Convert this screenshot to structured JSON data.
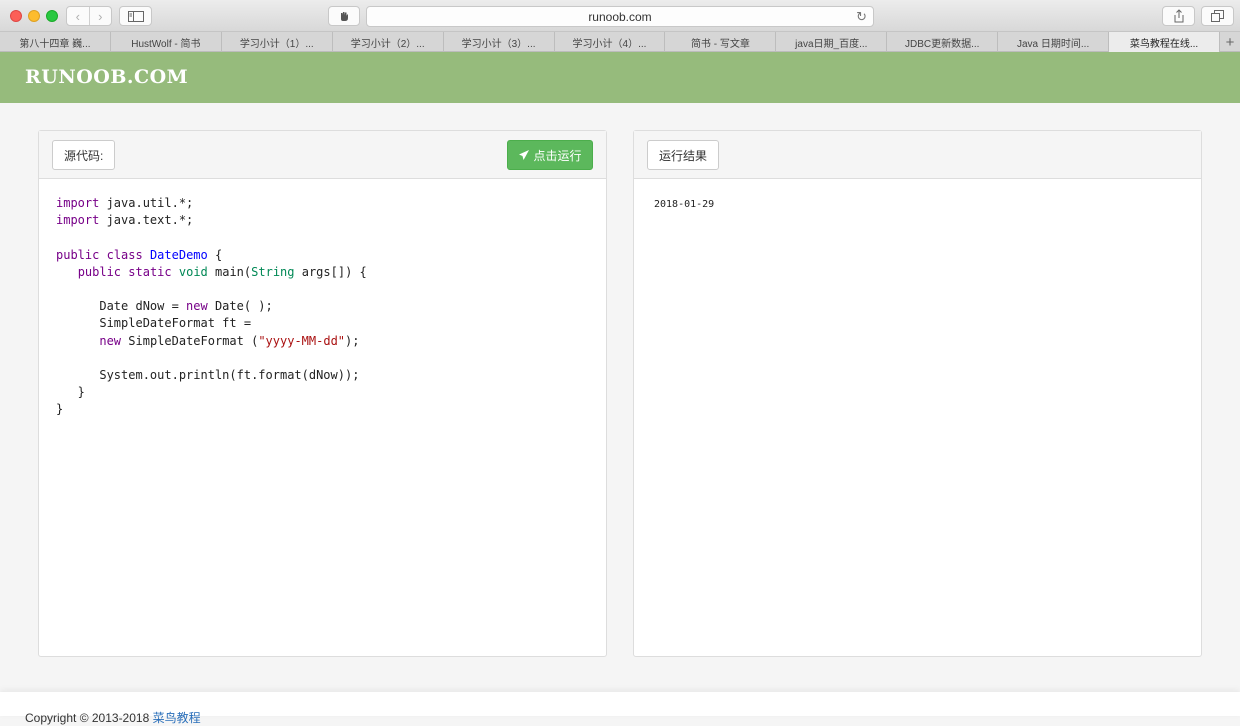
{
  "browser": {
    "url": "runoob.com",
    "tabs": [
      {
        "title": "第八十四章 巍..."
      },
      {
        "title": "HustWolf - 简书"
      },
      {
        "title": "学习小计（1）..."
      },
      {
        "title": "学习小计（2）..."
      },
      {
        "title": "学习小计（3）..."
      },
      {
        "title": "学习小计（4）..."
      },
      {
        "title": "简书 - 写文章"
      },
      {
        "title": "java日期_百度..."
      },
      {
        "title": "JDBC更新数据..."
      },
      {
        "title": "Java 日期时间..."
      },
      {
        "title": "菜鸟教程在线..."
      }
    ],
    "active_tab": 10,
    "add_tab_glyph": "+"
  },
  "site": {
    "logo": "RUNOOB.COM",
    "header_color": "#96bb7c"
  },
  "editor": {
    "source_label": "源代码:",
    "run_label": "点击运行",
    "run_color": "#5cb85c",
    "code_lines": [
      "import java.util.*;",
      "import java.text.*;",
      "",
      "public class DateDemo {",
      "   public static void main(String args[]) {",
      "",
      "      Date dNow = new Date( );",
      "      SimpleDateFormat ft =",
      "      new SimpleDateFormat (\"yyyy-MM-dd\");",
      "",
      "      System.out.println(ft.format(dNow));",
      "   }",
      "}"
    ]
  },
  "result": {
    "label": "运行结果",
    "output": "2018-01-29"
  },
  "footer": {
    "text": "Copyright © 2013-2018 ",
    "link": "菜鸟教程"
  }
}
